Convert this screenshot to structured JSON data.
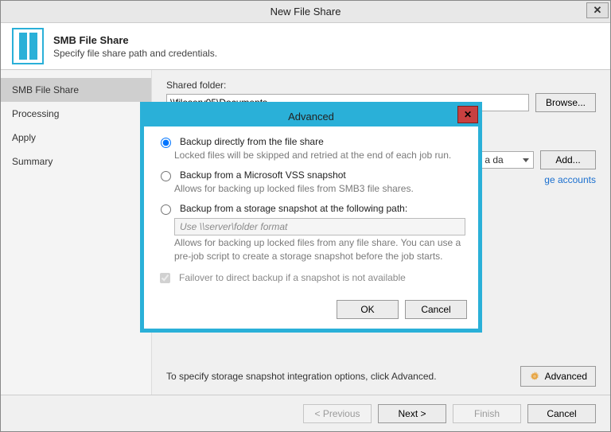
{
  "window": {
    "title": "New File Share",
    "close_glyph": "✕"
  },
  "header": {
    "title": "SMB File Share",
    "subtitle": "Specify file share path and credentials."
  },
  "sidebar": {
    "steps": [
      {
        "label": "SMB File Share",
        "active": true
      },
      {
        "label": "Processing"
      },
      {
        "label": "Apply"
      },
      {
        "label": "Summary"
      }
    ]
  },
  "main": {
    "shared_folder_label": "Shared folder:",
    "shared_folder_value": "\\\\fileserv05\\Documents",
    "browse_label": "Browse...",
    "io_select_value": "han a da",
    "add_label": "Add...",
    "accounts_link": "ge accounts",
    "hint": "To specify storage snapshot integration options, click Advanced.",
    "advanced_label": "Advanced"
  },
  "footer": {
    "previous": "< Previous",
    "next": "Next >",
    "finish": "Finish",
    "cancel": "Cancel"
  },
  "modal": {
    "title": "Advanced",
    "close_glyph": "✕",
    "options": [
      {
        "title": "Backup directly from the file share",
        "desc": "Locked files will be skipped and retried at the end of each job run.",
        "selected": true
      },
      {
        "title": "Backup from a Microsoft VSS snapshot",
        "desc": "Allows for backing up locked files from SMB3 file shares.",
        "selected": false
      },
      {
        "title": "Backup from a storage snapshot at the following path:",
        "desc": "Allows for backing up locked files from any file share. You can use a pre-job script to create a storage snapshot before the job starts.",
        "selected": false,
        "path_placeholder": "Use \\\\server\\folder format"
      }
    ],
    "failover_label": "Failover to direct backup if a snapshot is not available",
    "failover_checked": true,
    "ok": "OK",
    "cancel": "Cancel"
  }
}
